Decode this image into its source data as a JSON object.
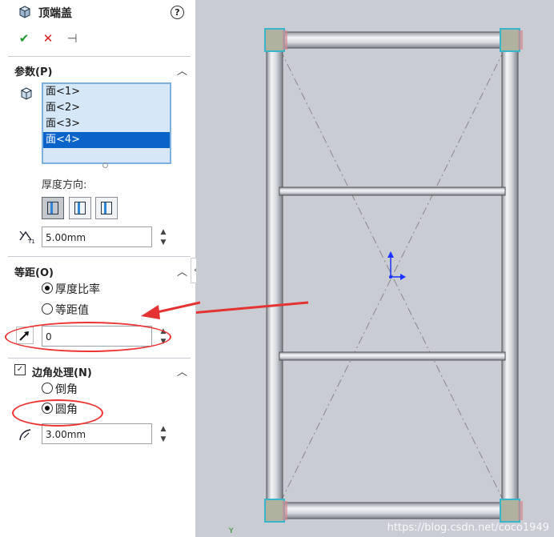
{
  "feature": {
    "title": "顶端盖",
    "help_icon": "help-icon"
  },
  "actions": [
    {
      "name": "ok-button",
      "glyph": "✔",
      "color": "#1f9a2e"
    },
    {
      "name": "cancel-button",
      "glyph": "✕",
      "color": "#d71c1c"
    },
    {
      "name": "pin-button",
      "glyph": "⊣",
      "color": "#555555"
    }
  ],
  "params": {
    "header": "参数(P)",
    "faces": [
      "面<1>",
      "面<2>",
      "面<3>",
      "面<4>"
    ],
    "selected_index": 3,
    "thickness_direction_label": "厚度方向:",
    "thickness_value": "5.00mm"
  },
  "offset": {
    "header": "等距(O)",
    "options": [
      "厚度比率",
      "等距值"
    ],
    "selected_index": 0,
    "value": "0"
  },
  "corner": {
    "header": "边角处理(N)",
    "enabled": true,
    "options": [
      "倒角",
      "圆角"
    ],
    "selected_index": 1,
    "radius_value": "3.00mm"
  },
  "viewport": {
    "background": "#c9ccd3",
    "watermark": "https://blog.csdn.net/coco1949",
    "triad_label": "Y"
  },
  "annotation_color": "#e33333"
}
